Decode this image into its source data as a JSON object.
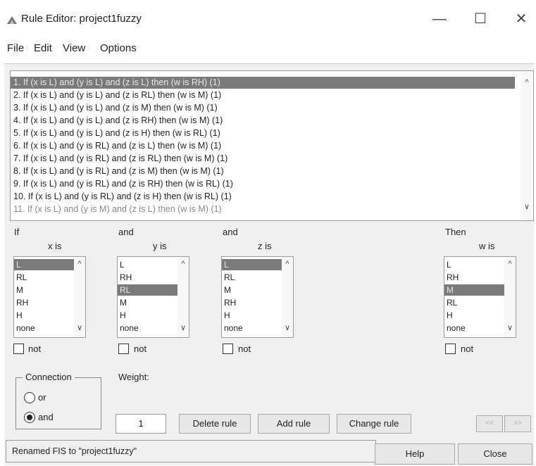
{
  "window": {
    "title": "Rule Editor: project1fuzzy",
    "minimize": "—",
    "maximize": "☐",
    "close": "✕"
  },
  "menu": [
    "File",
    "Edit",
    "View",
    "Options"
  ],
  "rules": [
    "1. If (x is L) and (y is L) and (z is L) then (w is RH) (1)",
    "2. If (x is L) and (y is L) and (z is RL) then (w is M) (1)",
    "3. If (x is L) and (y is L) and (z is M) then (w is M) (1)",
    "4. If (x is L) and (y is L) and (z is RH) then (w is M) (1)",
    "5. If (x is L) and (y is L) and (z is H) then (w is RL) (1)",
    "6. If (x is L) and (y is RL) and (z is L) then (w is M) (1)",
    "7. If (x is L) and (y is RL) and (z is RL) then (w is M) (1)",
    "8. If (x is L) and (y is RL) and (z is M) then (w is M) (1)",
    "9. If (x is L) and (y is RL) and (z is RH) then (w is RL) (1)",
    "10. If (x is L) and (y is RL) and (z is H) then (w is RL) (1)",
    "11. If (x is L) and (y is M) and (z is L) then (w is M) (1)"
  ],
  "selected_rule_index": 0,
  "columns": {
    "x": {
      "connector": "If",
      "var_label": "x is",
      "options": [
        "L",
        "RL",
        "M",
        "RH",
        "H",
        "none"
      ],
      "selected": "L",
      "not_label": "not"
    },
    "y": {
      "connector": "and",
      "var_label": "y is",
      "options": [
        "L",
        "RH",
        "RL",
        "M",
        "H",
        "none"
      ],
      "selected": "RL",
      "not_label": "not"
    },
    "z": {
      "connector": "and",
      "var_label": "z is",
      "options": [
        "L",
        "RL",
        "M",
        "RH",
        "H",
        "none"
      ],
      "selected": "L",
      "not_label": "not"
    },
    "w": {
      "connector": "Then",
      "var_label": "w is",
      "options": [
        "L",
        "RH",
        "M",
        "RL",
        "H",
        "none"
      ],
      "selected": "M",
      "not_label": "not"
    }
  },
  "connection": {
    "label": "Connection",
    "or_label": "or",
    "and_label": "and",
    "selected": "and"
  },
  "weight": {
    "label": "Weight:",
    "value": "1"
  },
  "buttons": {
    "delete_rule": "Delete rule",
    "add_rule": "Add rule",
    "change_rule": "Change rule",
    "prev": "<<",
    "next": ">>",
    "help": "Help",
    "close": "Close"
  },
  "status": "Renamed FIS to \"project1fuzzy\""
}
